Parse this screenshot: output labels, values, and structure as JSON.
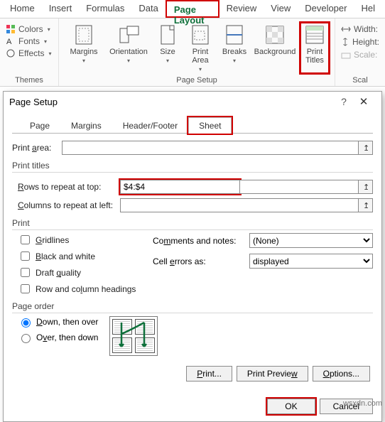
{
  "ribbon": {
    "tabs": [
      "Home",
      "Insert",
      "Formulas",
      "Data",
      "Page Layout",
      "Review",
      "View",
      "Developer",
      "Hel"
    ],
    "active_tab": "Page Layout",
    "themes": {
      "colors_label": "Colors",
      "fonts_label": "Fonts",
      "effects_label": "Effects",
      "group_label": "Themes"
    },
    "pagesetup": {
      "items": [
        "Margins",
        "Orientation",
        "Size",
        "Print Area",
        "Breaks",
        "Background",
        "Print Titles"
      ],
      "group_label": "Page Setup"
    },
    "scale": {
      "width_label": "Width:",
      "height_label": "Height:",
      "scale_label": "Scale:",
      "group_label": "Scal"
    }
  },
  "dialog": {
    "title": "Page Setup",
    "tabs": [
      "Page",
      "Margins",
      "Header/Footer",
      "Sheet"
    ],
    "active_tab": "Sheet",
    "print_area_label": "Print area:",
    "print_area_value": "",
    "print_titles_label": "Print titles",
    "rows_label": "Rows to repeat at top:",
    "rows_value": "$4:$4",
    "cols_label": "Columns to repeat at left:",
    "cols_value": "",
    "print_section_label": "Print",
    "chk_gridlines": "Gridlines",
    "chk_bw": "Black and white",
    "chk_draft": "Draft quality",
    "chk_rowcol": "Row and column headings",
    "comments_label": "Comments and notes:",
    "comments_value": "(None)",
    "errors_label": "Cell errors as:",
    "errors_value": "displayed",
    "page_order_label": "Page order",
    "order_down": "Down, then over",
    "order_over": "Over, then down",
    "btn_print": "Print...",
    "btn_preview": "Print Preview",
    "btn_options": "Options...",
    "btn_ok": "OK",
    "btn_cancel": "Cancel"
  },
  "watermark": "wsxdn.com"
}
